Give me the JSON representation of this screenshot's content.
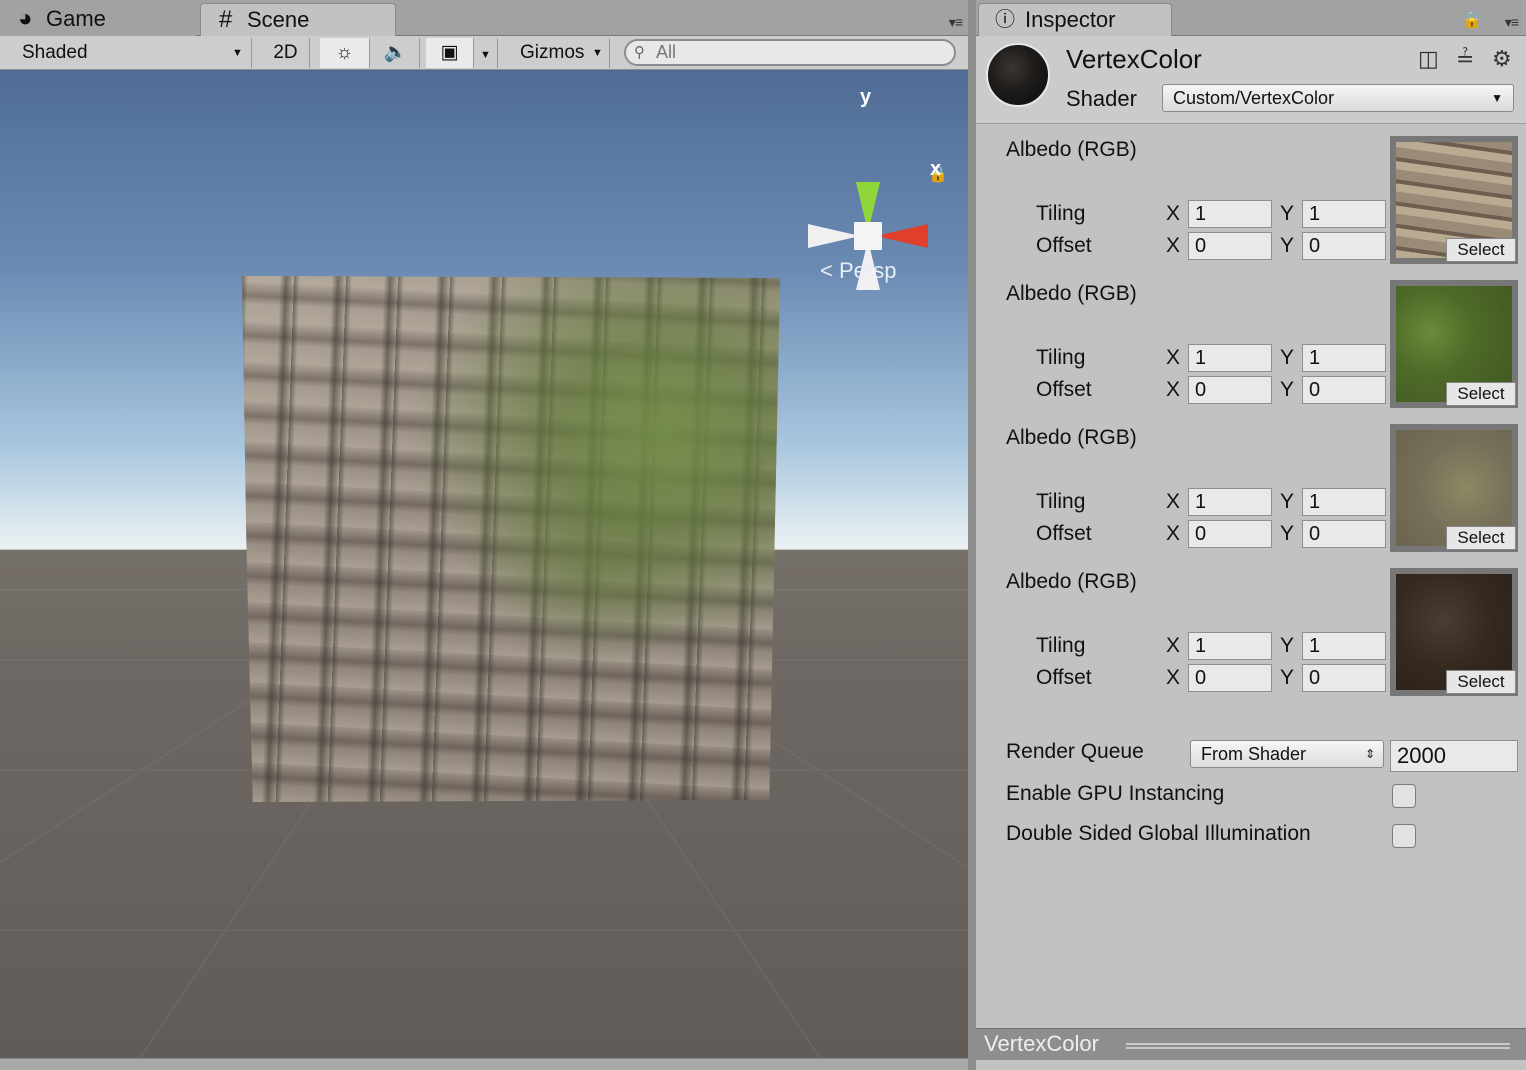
{
  "scene": {
    "tabs": [
      {
        "label": "Game",
        "icon": "pacman-icon"
      },
      {
        "label": "Scene",
        "icon": "hash-icon"
      }
    ],
    "toolbar": {
      "draw_mode": "Shaded",
      "mode_2d": "2D",
      "lighting_icon": "sun-icon",
      "audio_icon": "speaker-icon",
      "effects_icon": "image-icon",
      "gizmos": "Gizmos",
      "search_placeholder": "All"
    },
    "gizmo": {
      "y_label": "y",
      "x_label": "x",
      "projection": "Persp"
    },
    "colors": {
      "sky_top": "#506c95",
      "horizon": "#eaf0f2",
      "ground": "#6e6864",
      "x_axis": "#e0402a",
      "y_axis": "#8fd63a"
    }
  },
  "inspector": {
    "tab_label": "Inspector",
    "material_name": "VertexColor",
    "shader_label": "Shader",
    "shader_value": "Custom/VertexColor",
    "textures": [
      {
        "label": "Albedo (RGB)",
        "tiling_label": "Tiling",
        "offset_label": "Offset",
        "tiling_x": "1",
        "tiling_y": "1",
        "offset_x": "0",
        "offset_y": "0",
        "select": "Select",
        "swatch": "rock"
      },
      {
        "label": "Albedo (RGB)",
        "tiling_label": "Tiling",
        "offset_label": "Offset",
        "tiling_x": "1",
        "tiling_y": "1",
        "offset_x": "0",
        "offset_y": "0",
        "select": "Select",
        "swatch": "grass"
      },
      {
        "label": "Albedo (RGB)",
        "tiling_label": "Tiling",
        "offset_label": "Offset",
        "tiling_x": "1",
        "tiling_y": "1",
        "offset_x": "0",
        "offset_y": "0",
        "select": "Select",
        "swatch": "dry-grass"
      },
      {
        "label": "Albedo (RGB)",
        "tiling_label": "Tiling",
        "offset_label": "Offset",
        "tiling_x": "1",
        "tiling_y": "1",
        "offset_x": "0",
        "offset_y": "0",
        "select": "Select",
        "swatch": "dirt"
      }
    ],
    "xy_labels": {
      "x": "X",
      "y": "Y"
    },
    "render_queue_label": "Render Queue",
    "render_queue_mode": "From Shader",
    "render_queue_value": "2000",
    "gpu_instancing_label": "Enable GPU Instancing",
    "double_sided_gi_label": "Double Sided Global Illumination",
    "gpu_instancing_checked": false,
    "double_sided_gi_checked": false,
    "footer_title": "VertexColor"
  }
}
